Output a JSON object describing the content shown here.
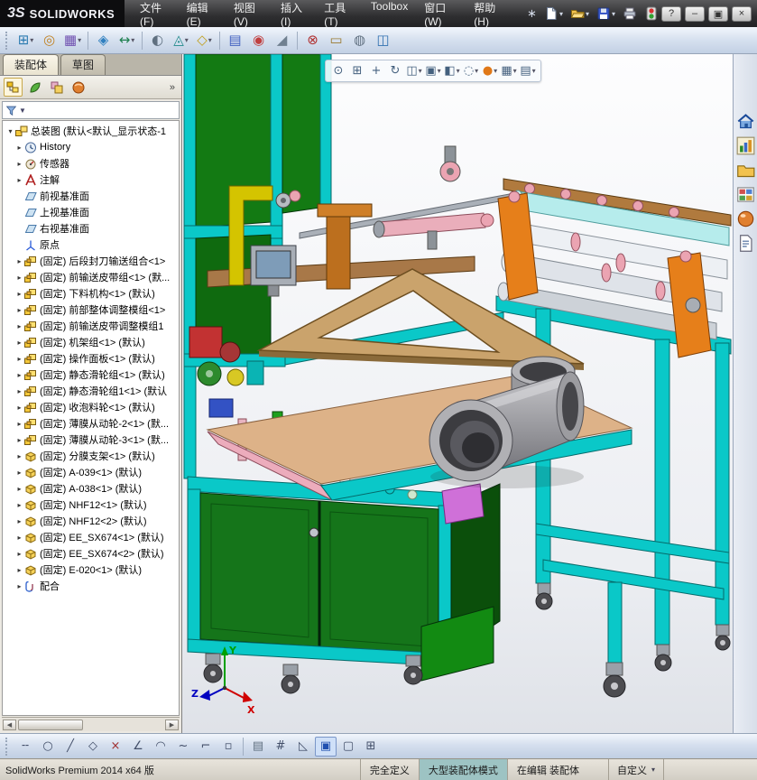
{
  "titlebar": {
    "brand_mark": "3S",
    "brand_name": "SOLIDWORKS",
    "window_buttons": [
      {
        "name": "help",
        "glyph": "?"
      },
      {
        "name": "minimize",
        "glyph": "–"
      },
      {
        "name": "restore",
        "glyph": "▣"
      },
      {
        "name": "close",
        "glyph": "×"
      }
    ]
  },
  "icons": {
    "chevron_down": "▾",
    "scroll_left": "◀",
    "scroll_right": "▶"
  },
  "menubar": {
    "items": [
      "文件(F)",
      "编辑(E)",
      "视图(V)",
      "插入(I)",
      "工具(T)",
      "Toolbox",
      "窗口(W)",
      "帮助(H)"
    ]
  },
  "quick_toolbar": {
    "items": [
      {
        "name": "search",
        "glyph": "∗"
      },
      {
        "name": "new-document",
        "icon": "new-doc",
        "dd": true
      },
      {
        "name": "open-document",
        "icon": "open-folder",
        "dd": true
      },
      {
        "name": "save-document",
        "icon": "save",
        "dd": true
      },
      {
        "name": "print-document",
        "icon": "print"
      },
      {
        "name": "rebuild",
        "icon": "rebuild"
      }
    ]
  },
  "assembly_toolbar": {
    "items": [
      {
        "name": "insert-component",
        "glyph": "⊞",
        "color": "#2a7ab0",
        "dd": true
      },
      {
        "name": "mate",
        "glyph": "◎",
        "color": "#c08020"
      },
      {
        "name": "linear-component-pattern",
        "glyph": "▦",
        "color": "#7050b0",
        "dd": true
      },
      {
        "sep": true
      },
      {
        "name": "smart-fasteners",
        "glyph": "◈",
        "color": "#3080c0"
      },
      {
        "name": "move-component",
        "glyph": "↔",
        "color": "#208050",
        "dd": true
      },
      {
        "sep": true
      },
      {
        "name": "show-hidden-components",
        "glyph": "◐",
        "color": "#607080"
      },
      {
        "name": "assembly-features",
        "glyph": "◬",
        "color": "#1f8a8a",
        "dd": true
      },
      {
        "name": "reference-geometry",
        "glyph": "◇",
        "color": "#c0a020",
        "dd": true
      },
      {
        "sep": true
      },
      {
        "name": "bill-of-materials",
        "glyph": "▤",
        "color": "#4060c0"
      },
      {
        "name": "exploded-view",
        "glyph": "◉",
        "color": "#c04040"
      },
      {
        "name": "explode-line-sketch",
        "glyph": "◢",
        "color": "#708090"
      },
      {
        "sep": true
      },
      {
        "name": "interference-detection",
        "glyph": "⊗",
        "color": "#b03030"
      },
      {
        "name": "measure",
        "glyph": "▭",
        "color": "#9a7a30"
      },
      {
        "name": "mass-properties",
        "glyph": "◍",
        "color": "#607080"
      },
      {
        "name": "section-view-tool",
        "glyph": "◫",
        "color": "#3070b0"
      }
    ]
  },
  "panel": {
    "tabs": [
      "装配体",
      "草图"
    ],
    "fm_tabs": [
      {
        "name": "featuremanager-tree",
        "icon": "fm-tree",
        "active": true
      },
      {
        "name": "propertymanager",
        "icon": "fm-prop"
      },
      {
        "name": "configurationmanager",
        "icon": "fm-config"
      },
      {
        "name": "displaymanager",
        "icon": "fm-display"
      }
    ],
    "more_glyph": "»",
    "filter_chevron": "▼"
  },
  "tree": {
    "items": [
      {
        "arrow": "open",
        "icon": "asm-root",
        "label": "总装图 (默认<默认_显示状态-1"
      },
      {
        "arrow": "closed",
        "icon": "history",
        "label": "History"
      },
      {
        "arrow": "closed",
        "icon": "sensor",
        "label": "传感器"
      },
      {
        "arrow": "closed",
        "icon": "annot",
        "label": "注解"
      },
      {
        "arrow": "none",
        "icon": "plane",
        "label": "前视基准面"
      },
      {
        "arrow": "none",
        "icon": "plane",
        "label": "上视基准面"
      },
      {
        "arrow": "none",
        "icon": "plane",
        "label": "右视基准面"
      },
      {
        "arrow": "none",
        "icon": "origin",
        "label": "原点"
      },
      {
        "arrow": "closed",
        "icon": "subasm",
        "label": "(固定) 后段封刀输送组合<1>"
      },
      {
        "arrow": "closed",
        "icon": "subasm",
        "label": "(固定) 前输送皮带组<1> (默..."
      },
      {
        "arrow": "closed",
        "icon": "subasm",
        "label": "(固定) 下料机构<1> (默认)"
      },
      {
        "arrow": "closed",
        "icon": "subasm",
        "label": "(固定) 前部整体调整模组<1>"
      },
      {
        "arrow": "closed",
        "icon": "subasm",
        "label": "(固定) 前输送皮带调整模组1"
      },
      {
        "arrow": "closed",
        "icon": "subasm",
        "label": "(固定) 机架组<1> (默认)"
      },
      {
        "arrow": "closed",
        "icon": "subasm",
        "label": "(固定) 操作面板<1> (默认)"
      },
      {
        "arrow": "closed",
        "icon": "subasm",
        "label": "(固定) 静态滑轮组<1> (默认)"
      },
      {
        "arrow": "closed",
        "icon": "subasm",
        "label": "(固定) 静态滑轮组1<1> (默认"
      },
      {
        "arrow": "closed",
        "icon": "subasm",
        "label": "(固定) 收泡料轮<1> (默认)"
      },
      {
        "arrow": "closed",
        "icon": "subasm",
        "label": "(固定) 薄膜从动轮-2<1> (默..."
      },
      {
        "arrow": "closed",
        "icon": "subasm",
        "label": "(固定) 薄膜从动轮-3<1> (默..."
      },
      {
        "arrow": "closed",
        "icon": "part",
        "label": "(固定) 分膜支架<1> (默认)"
      },
      {
        "arrow": "closed",
        "icon": "part",
        "label": "(固定) A-039<1> (默认)"
      },
      {
        "arrow": "closed",
        "icon": "part",
        "label": "(固定) A-038<1> (默认)"
      },
      {
        "arrow": "closed",
        "icon": "part",
        "label": "(固定) NHF12<1> (默认)"
      },
      {
        "arrow": "closed",
        "icon": "part",
        "label": "(固定) NHF12<2> (默认)"
      },
      {
        "arrow": "closed",
        "icon": "part",
        "label": "(固定) EE_SX674<1> (默认)"
      },
      {
        "arrow": "closed",
        "icon": "part",
        "label": "(固定) EE_SX674<2> (默认)"
      },
      {
        "arrow": "closed",
        "icon": "part",
        "label": "(固定) E-020<1> (默认)"
      },
      {
        "arrow": "closed",
        "icon": "mate",
        "label": "配合"
      }
    ]
  },
  "viewport_toolbar": {
    "items": [
      {
        "name": "zoom-fit",
        "glyph": "⊙"
      },
      {
        "name": "zoom-area",
        "glyph": "⊞"
      },
      {
        "name": "pan",
        "glyph": "+"
      },
      {
        "name": "rotate-view",
        "glyph": "↻"
      },
      {
        "name": "section-view",
        "glyph": "◫",
        "dd": true
      },
      {
        "name": "view-orientation",
        "glyph": "▣",
        "dd": true
      },
      {
        "name": "display-style",
        "glyph": "◧",
        "dd": true
      },
      {
        "name": "hide-show-items",
        "glyph": "◌",
        "dd": true
      },
      {
        "name": "edit-appearance",
        "glyph": "●",
        "color": "#e07818",
        "dd": true
      },
      {
        "name": "apply-scene",
        "glyph": "▦",
        "dd": true
      },
      {
        "name": "view-settings",
        "glyph": "▤",
        "dd": true
      }
    ]
  },
  "taskpane": {
    "items": [
      {
        "name": "solidworks-resources",
        "icon": "house"
      },
      {
        "name": "design-library",
        "icon": "chart"
      },
      {
        "name": "file-explorer",
        "icon": "folder"
      },
      {
        "name": "view-palette",
        "icon": "palette"
      },
      {
        "name": "appearances-scenes",
        "icon": "sphere"
      },
      {
        "name": "custom-properties",
        "icon": "doc-props"
      }
    ]
  },
  "sketch_toolbar": {
    "items": [
      {
        "name": "centerline",
        "glyph": "╌",
        "color": "#44506a"
      },
      {
        "name": "circle",
        "glyph": "○",
        "color": "#44506a"
      },
      {
        "name": "line",
        "glyph": "╱",
        "color": "#44506a"
      },
      {
        "name": "polygon",
        "glyph": "◇",
        "color": "#44506a"
      },
      {
        "name": "trim-entities",
        "glyph": "×",
        "color": "#a03030"
      },
      {
        "name": "sketch-fillet",
        "glyph": "∠",
        "color": "#44506a"
      },
      {
        "name": "arc",
        "glyph": "◠",
        "color": "#44506a"
      },
      {
        "name": "spline",
        "glyph": "~",
        "color": "#44506a"
      },
      {
        "name": "corner-rectangle",
        "glyph": "⌐",
        "color": "#44506a"
      },
      {
        "name": "point",
        "glyph": "▫",
        "color": "#44506a"
      },
      {
        "sep": true
      },
      {
        "name": "erase",
        "glyph": "▤",
        "color": "#607080"
      },
      {
        "name": "grid-snap",
        "glyph": "#",
        "color": "#44506a"
      },
      {
        "name": "triangle-tool",
        "glyph": "◺",
        "color": "#44506a"
      },
      {
        "name": "shaded-sketch",
        "glyph": "▣",
        "color": "#2050b0",
        "active": true
      },
      {
        "name": "plane-display",
        "glyph": "▢",
        "color": "#44506a"
      },
      {
        "name": "grid-settings",
        "glyph": "⊞",
        "color": "#44506a"
      }
    ]
  },
  "statusbar": {
    "app": "SolidWorks Premium 2014 x64 版",
    "define_state": "完全定义",
    "mode": "大型装配体模式",
    "editing": "在编辑 装配体",
    "custom": "自定义"
  },
  "scene": {
    "triad": {
      "x": "X",
      "y": "Y",
      "z": "Z"
    },
    "colors": {
      "frame_cyan": "#0ac8c8",
      "panel_green": "#137a13",
      "board_tan": "#ddb288",
      "pipe_gray": "#9a9a9e",
      "roller_pink": "#eba4b2",
      "bracket_orange": "#e67f1a",
      "cabinet_green": "#15751a"
    }
  }
}
